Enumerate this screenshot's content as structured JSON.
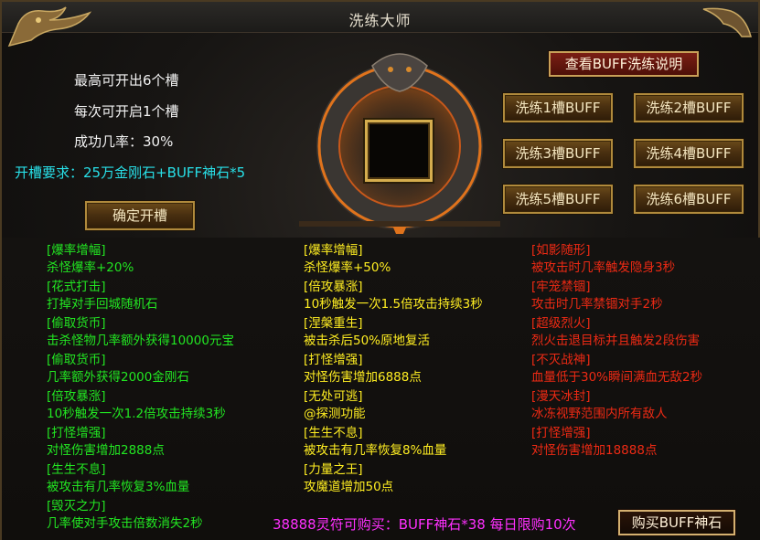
{
  "window": {
    "title": "洗练大师",
    "close_icon": "✕"
  },
  "info": {
    "max_slots": "最高可开出6个槽",
    "per_open": "每次可开启1个槽",
    "success_rate": "成功几率：30%",
    "requirement": "开槽要求：25万金刚石+BUFF神石*5"
  },
  "buttons": {
    "confirm_open": "确定开槽",
    "view_explain": "查看BUFF洗练说明",
    "refine": [
      "洗练1槽BUFF",
      "洗练2槽BUFF",
      "洗练3槽BUFF",
      "洗练4槽BUFF",
      "洗练5槽BUFF",
      "洗练6槽BUFF"
    ],
    "buy": "购买BUFF神石"
  },
  "lists": {
    "green": [
      {
        "name": "[爆率增幅]",
        "desc": "杀怪爆率+20%"
      },
      {
        "name": "[花式打击]",
        "desc": "打掉对手回城随机石"
      },
      {
        "name": "[偷取货币]",
        "desc": "击杀怪物几率额外获得10000元宝"
      },
      {
        "name": "[偷取货币]",
        "desc": "几率额外获得2000金刚石"
      },
      {
        "name": "[倍攻暴涨]",
        "desc": "10秒触发一次1.2倍攻击持续3秒"
      },
      {
        "name": "[打怪增强]",
        "desc": "对怪伤害增加2888点"
      },
      {
        "name": "[生生不息]",
        "desc": "被攻击有几率恢复3%血量"
      },
      {
        "name": "[毁灭之力]",
        "desc": "几率使对手攻击倍数消失2秒"
      }
    ],
    "yellow": [
      {
        "name": "[爆率增幅]",
        "desc": "杀怪爆率+50%"
      },
      {
        "name": "[倍攻暴涨]",
        "desc": "10秒触发一次1.5倍攻击持续3秒"
      },
      {
        "name": "[涅槃重生]",
        "desc": "被击杀后50%原地复活"
      },
      {
        "name": "[打怪增强]",
        "desc": "对怪伤害增加6888点"
      },
      {
        "name": "[无处可逃]",
        "desc": "@探测功能"
      },
      {
        "name": "[生生不息]",
        "desc": "被攻击有几率恢复8%血量"
      },
      {
        "name": "[力量之王]",
        "desc": "攻魔道增加50点"
      }
    ],
    "red": [
      {
        "name": "[如影随形]",
        "desc": "被攻击时几率触发隐身3秒"
      },
      {
        "name": "[牢笼禁锢]",
        "desc": "攻击时几率禁锢对手2秒"
      },
      {
        "name": "[超级烈火]",
        "desc": "烈火击退目标并且触发2段伤害"
      },
      {
        "name": "[不灭战神]",
        "desc": "血量低于30%瞬间满血无敌2秒"
      },
      {
        "name": "[漫天冰封]",
        "desc": "冰冻视野范围内所有敌人"
      },
      {
        "name": "[打怪增强]",
        "desc": "对怪伤害增加18888点"
      }
    ]
  },
  "footer": {
    "promo": "38888灵符可购买：BUFF神石*38   每日限购10次"
  },
  "colors": {
    "green_text": "#22e622",
    "yellow_text": "#ffee22",
    "red_text": "#ee2a14",
    "cyan_text": "#28e0e8",
    "magenta_text": "#ff30ff",
    "gold_border": "#b08a3c"
  },
  "icons": {
    "corner_left": "dragon-ornament-icon",
    "corner_right": "dragon-ornament-icon",
    "center_ring": "dragon-ring-icon"
  }
}
